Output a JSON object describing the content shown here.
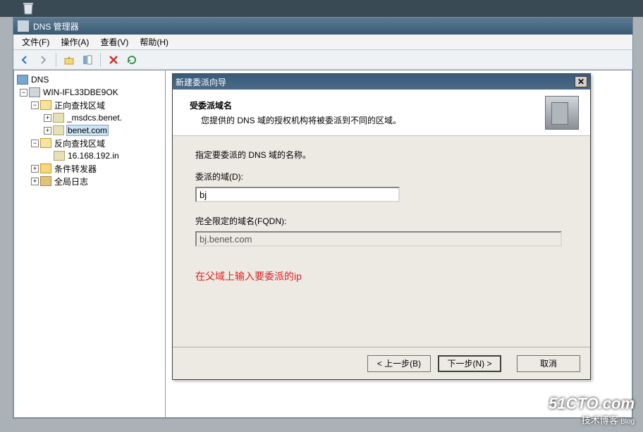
{
  "window": {
    "title": "DNS 管理器"
  },
  "menu": {
    "file": "文件(F)",
    "action": "操作(A)",
    "view": "查看(V)",
    "help": "帮助(H)"
  },
  "tree": {
    "root": "DNS",
    "server": "WIN-IFL33DBE9OK",
    "fwd_zone": "正向查找区域",
    "zone_msdcs": "_msdcs.benet.",
    "zone_benet": "benet.com",
    "rev_zone": "反向查找区域",
    "rev_item": "16.168.192.in",
    "cond_fwd": "条件转发器",
    "global_log": "全局日志"
  },
  "dialog": {
    "title": "新建委派向导",
    "header_title": "受委派域名",
    "header_desc": "您提供的 DNS 域的授权机构将被委派到不同的区域。",
    "instruct": "指定要委派的 DNS 域的名称。",
    "delegated_label": "委派的域(D):",
    "delegated_value": "bj",
    "fqdn_label": "完全限定的域名(FQDN):",
    "fqdn_value": "bj.benet.com",
    "annotation": "在父域上输入要委派的ip",
    "btn_back": "< 上一步(B)",
    "btn_next": "下一步(N) >",
    "btn_cancel": "取消"
  },
  "watermark": {
    "big": "51CTO.com",
    "small": "技术博客",
    "blog": "Blog"
  }
}
